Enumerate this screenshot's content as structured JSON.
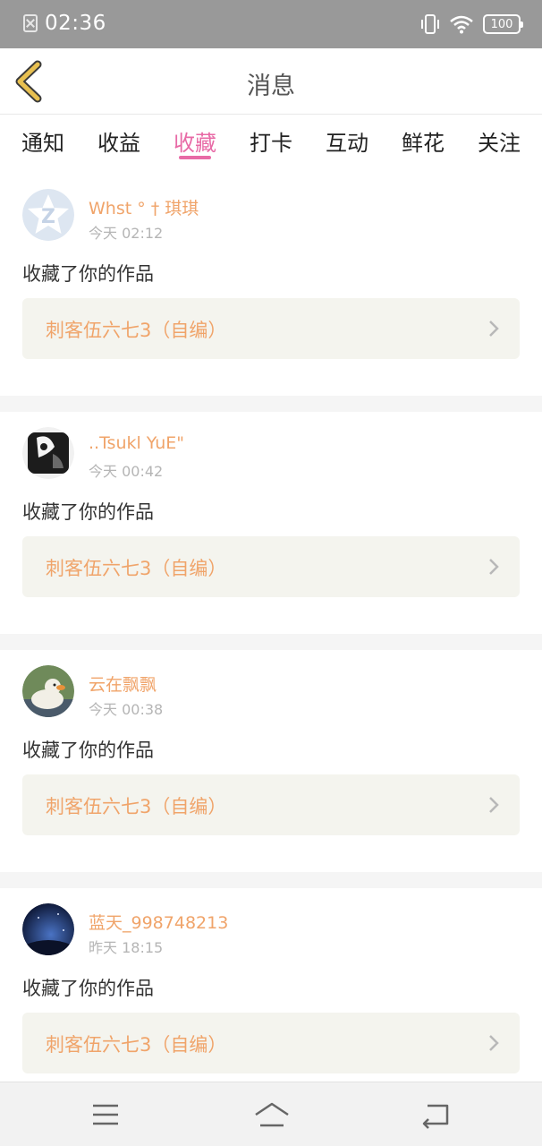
{
  "status_bar": {
    "time": "02:36",
    "battery": "100"
  },
  "header": {
    "title": "消息"
  },
  "tabs": [
    {
      "label": "通知",
      "active": false
    },
    {
      "label": "收益",
      "active": false
    },
    {
      "label": "收藏",
      "active": true
    },
    {
      "label": "打卡",
      "active": false
    },
    {
      "label": "互动",
      "active": false
    },
    {
      "label": "鲜花",
      "active": false
    },
    {
      "label": "关注",
      "active": false
    }
  ],
  "items": [
    {
      "user": "Whst ° † 琪琪",
      "time": "今天 02:12",
      "action": "收藏了你的作品",
      "work": "刺客伍六七3（自编）"
    },
    {
      "user": "..Tsukl YuE\"",
      "time": "今天 00:42",
      "action": "收藏了你的作品",
      "work": "刺客伍六七3（自编）"
    },
    {
      "user": "云在飘飘",
      "time": "今天 00:38",
      "action": "收藏了你的作品",
      "work": "刺客伍六七3（自编）"
    },
    {
      "user": "蓝天_998748213",
      "time": "昨天 18:15",
      "action": "收藏了你的作品",
      "work": "刺客伍六七3（自编）"
    }
  ],
  "colors": {
    "accent_pink": "#e86aa6",
    "username_orange": "#f0a46a",
    "back_arrow_yellow": "#e8c050"
  }
}
